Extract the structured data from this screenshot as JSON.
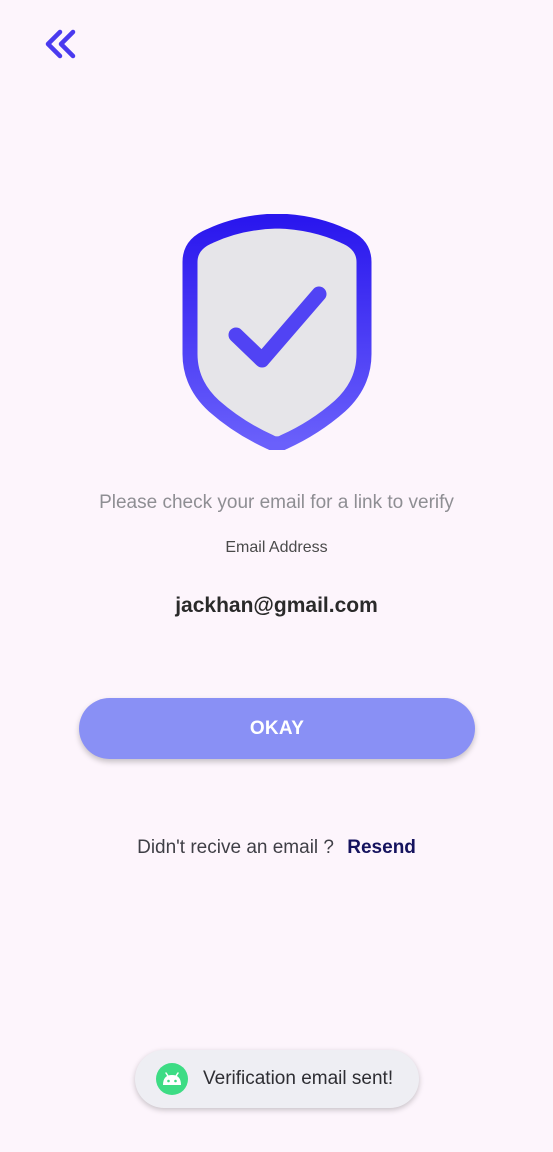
{
  "colors": {
    "background": "#fdf5fc",
    "accent": "#4a3aef",
    "button": "#8990f5",
    "link": "#15135e"
  },
  "header": {
    "back_icon": "double-chevron-left-icon"
  },
  "hero": {
    "icon": "shield-check-icon"
  },
  "main": {
    "instruction": "Please check your email for a link to verify",
    "email_label": "Email Address",
    "email_value": "jackhan@gmail.com",
    "okay_label": "OKAY",
    "resend_prompt": "Didn't recive an email ?",
    "resend_label": "Resend"
  },
  "toast": {
    "icon": "android-icon",
    "message": "Verification email sent!"
  }
}
